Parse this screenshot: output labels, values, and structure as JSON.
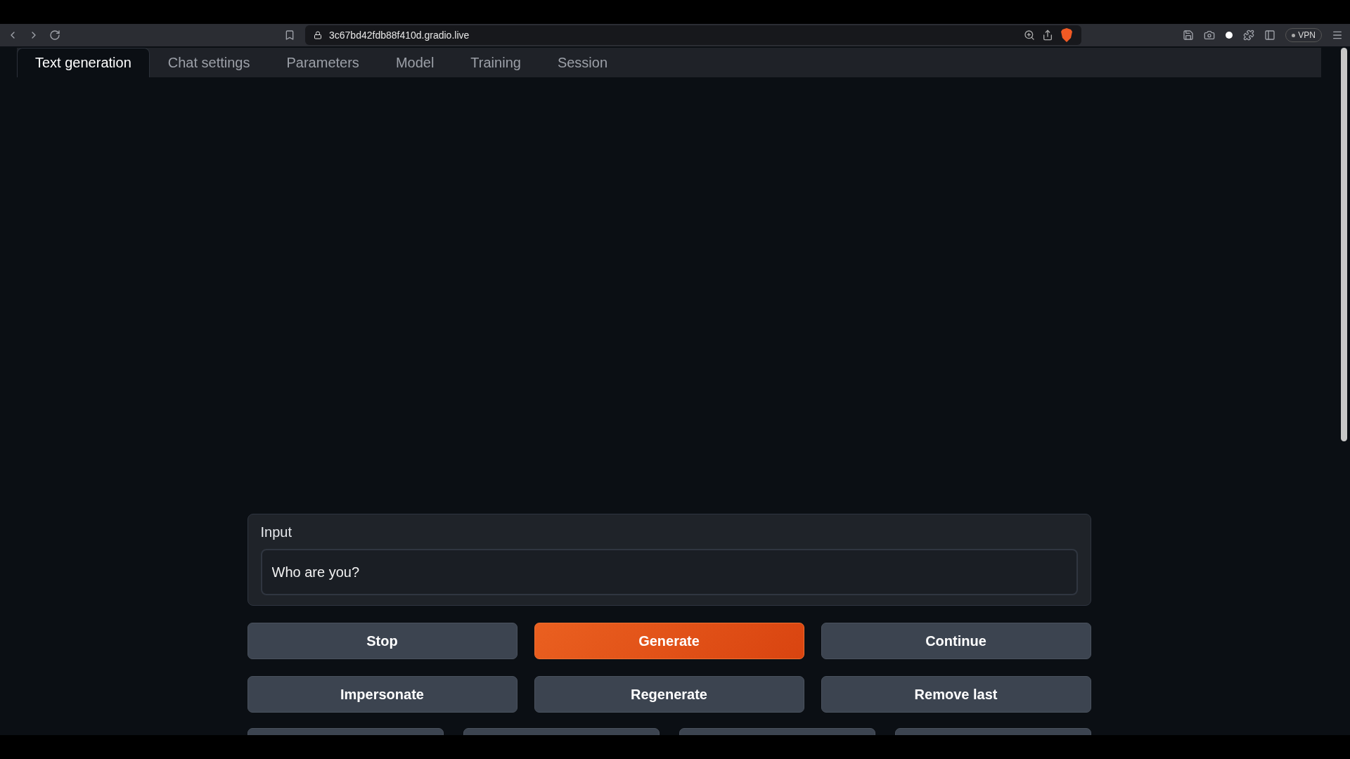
{
  "browser": {
    "url": "3c67bd42fdb88f410d.gradio.live",
    "vpn_label": "VPN"
  },
  "tabs": [
    {
      "label": "Text generation",
      "selected": true
    },
    {
      "label": "Chat settings",
      "selected": false
    },
    {
      "label": "Parameters",
      "selected": false
    },
    {
      "label": "Model",
      "selected": false
    },
    {
      "label": "Training",
      "selected": false
    },
    {
      "label": "Session",
      "selected": false
    }
  ],
  "input": {
    "label": "Input",
    "value": "Who are you?"
  },
  "buttons": [
    {
      "label": "Stop",
      "kind": "secondary"
    },
    {
      "label": "Generate",
      "kind": "primary"
    },
    {
      "label": "Continue",
      "kind": "secondary"
    },
    {
      "label": "Impersonate",
      "kind": "secondary"
    },
    {
      "label": "Regenerate",
      "kind": "secondary"
    },
    {
      "label": "Remove last",
      "kind": "secondary"
    }
  ]
}
